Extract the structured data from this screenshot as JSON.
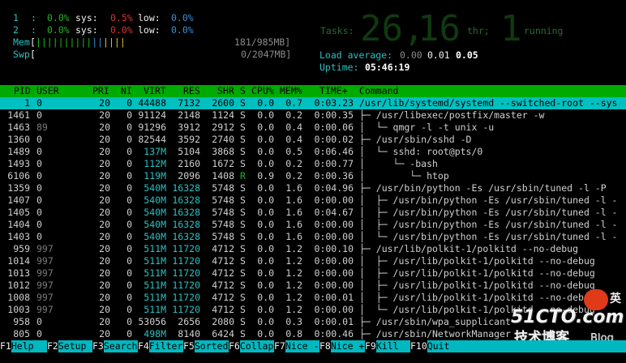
{
  "meters": {
    "cpu1": {
      "label": "1",
      "sep": ":",
      "user": "0.0%",
      "sys_label": "sys:",
      "sys": "0.5%",
      "low_label": "low:",
      "low": "0.0%"
    },
    "cpu2": {
      "label": "2",
      "sep": ":",
      "user": "0.0%",
      "sys_label": "sys:",
      "sys": "0.0%",
      "low_label": "low:",
      "low": "0.0%"
    },
    "mem": {
      "label": "Mem",
      "bar": "[||||||||||||||||",
      "value": "181/985MB]"
    },
    "swp": {
      "label": "Swp",
      "bar": "[",
      "value": "0/2047MB]"
    }
  },
  "stats": {
    "tasks_label": "Tasks:",
    "tasks": "26,",
    "thr_count": "16",
    "thr_label": "thr;",
    "running_count": "1",
    "running_label": "running",
    "load_label": "Load average:",
    "load1": "0.00",
    "load5": "0.01",
    "load15": "0.05",
    "uptime_label": "Uptime:",
    "uptime": "05:46:19"
  },
  "columns": [
    "PID",
    "USER",
    "PRI",
    "NI",
    "VIRT",
    "RES",
    "SHR",
    "S",
    "CPU%",
    "MEM%",
    "TIME+",
    "Command"
  ],
  "processes": [
    {
      "pid": "1",
      "user": "0",
      "pri": "20",
      "ni": "0",
      "virt": "44488",
      "res": "7132",
      "shr": "2600",
      "s": "S",
      "cpu": "0.0",
      "mem": "0.7",
      "time": "0:03.23",
      "cmd": "/usr/lib/systemd/systemd --switched-root --sys"
    },
    {
      "pid": "1461",
      "user": "0",
      "pri": "20",
      "ni": "0",
      "virt": "91124",
      "res": "2148",
      "shr": "1124",
      "s": "S",
      "cpu": "0.0",
      "mem": "0.2",
      "time": "0:00.35",
      "cmd": "├─ /usr/libexec/postfix/master -w"
    },
    {
      "pid": "1463",
      "user": "89",
      "pri": "20",
      "ni": "0",
      "virt": "91296",
      "res": "3912",
      "shr": "2912",
      "s": "S",
      "cpu": "0.0",
      "mem": "0.4",
      "time": "0:00.06",
      "cmd": "│  └─ qmgr -l -t unix -u"
    },
    {
      "pid": "1360",
      "user": "0",
      "pri": "20",
      "ni": "0",
      "virt": "82544",
      "res": "3592",
      "shr": "2740",
      "s": "S",
      "cpu": "0.0",
      "mem": "0.4",
      "time": "0:00.02",
      "cmd": "├─ /usr/sbin/sshd -D"
    },
    {
      "pid": "1489",
      "user": "0",
      "pri": "20",
      "ni": "0",
      "virt": "137M",
      "res": "5104",
      "shr": "3868",
      "s": "S",
      "cpu": "0.0",
      "mem": "0.5",
      "time": "0:06.46",
      "cmd": "│  └─ sshd: root@pts/0"
    },
    {
      "pid": "1493",
      "user": "0",
      "pri": "20",
      "ni": "0",
      "virt": "112M",
      "res": "2160",
      "shr": "1672",
      "s": "S",
      "cpu": "0.0",
      "mem": "0.2",
      "time": "0:00.77",
      "cmd": "│     └─ -bash"
    },
    {
      "pid": "6106",
      "user": "0",
      "pri": "20",
      "ni": "0",
      "virt": "119M",
      "res": "2096",
      "shr": "1408",
      "s": "R",
      "cpu": "0.9",
      "mem": "0.2",
      "time": "0:00.36",
      "cmd": "│        └─ htop"
    },
    {
      "pid": "1359",
      "user": "0",
      "pri": "20",
      "ni": "0",
      "virt": "540M",
      "res": "16328",
      "shr": "5748",
      "s": "S",
      "cpu": "0.0",
      "mem": "1.6",
      "time": "0:04.96",
      "cmd": "├─ /usr/bin/python -Es /usr/sbin/tuned -l -P"
    },
    {
      "pid": "1407",
      "user": "0",
      "pri": "20",
      "ni": "0",
      "virt": "540M",
      "res": "16328",
      "shr": "5748",
      "s": "S",
      "cpu": "0.0",
      "mem": "1.6",
      "time": "0:00.00",
      "cmd": "│  ├─ /usr/bin/python -Es /usr/sbin/tuned -l -"
    },
    {
      "pid": "1405",
      "user": "0",
      "pri": "20",
      "ni": "0",
      "virt": "540M",
      "res": "16328",
      "shr": "5748",
      "s": "S",
      "cpu": "0.0",
      "mem": "1.6",
      "time": "0:04.67",
      "cmd": "│  ├─ /usr/bin/python -Es /usr/sbin/tuned -l -"
    },
    {
      "pid": "1404",
      "user": "0",
      "pri": "20",
      "ni": "0",
      "virt": "540M",
      "res": "16328",
      "shr": "5748",
      "s": "S",
      "cpu": "0.0",
      "mem": "1.6",
      "time": "0:00.00",
      "cmd": "│  ├─ /usr/bin/python -Es /usr/sbin/tuned -l -"
    },
    {
      "pid": "1403",
      "user": "0",
      "pri": "20",
      "ni": "0",
      "virt": "540M",
      "res": "16328",
      "shr": "5748",
      "s": "S",
      "cpu": "0.0",
      "mem": "1.6",
      "time": "0:00.00",
      "cmd": "│  └─ /usr/bin/python -Es /usr/sbin/tuned -l -"
    },
    {
      "pid": "959",
      "user": "997",
      "pri": "20",
      "ni": "0",
      "virt": "511M",
      "res": "11720",
      "shr": "4712",
      "s": "S",
      "cpu": "0.0",
      "mem": "1.2",
      "time": "0:00.10",
      "cmd": "├─ /usr/lib/polkit-1/polkitd --no-debug"
    },
    {
      "pid": "1014",
      "user": "997",
      "pri": "20",
      "ni": "0",
      "virt": "511M",
      "res": "11720",
      "shr": "4712",
      "s": "S",
      "cpu": "0.0",
      "mem": "1.2",
      "time": "0:00.00",
      "cmd": "│  ├─ /usr/lib/polkit-1/polkitd --no-debug"
    },
    {
      "pid": "1013",
      "user": "997",
      "pri": "20",
      "ni": "0",
      "virt": "511M",
      "res": "11720",
      "shr": "4712",
      "s": "S",
      "cpu": "0.0",
      "mem": "1.2",
      "time": "0:00.00",
      "cmd": "│  ├─ /usr/lib/polkit-1/polkitd --no-debug"
    },
    {
      "pid": "1012",
      "user": "997",
      "pri": "20",
      "ni": "0",
      "virt": "511M",
      "res": "11720",
      "shr": "4712",
      "s": "S",
      "cpu": "0.0",
      "mem": "1.2",
      "time": "0:00.00",
      "cmd": "│  ├─ /usr/lib/polkit-1/polkitd --no-debug"
    },
    {
      "pid": "1008",
      "user": "997",
      "pri": "20",
      "ni": "0",
      "virt": "511M",
      "res": "11720",
      "shr": "4712",
      "s": "S",
      "cpu": "0.0",
      "mem": "1.2",
      "time": "0:00.01",
      "cmd": "│  ├─ /usr/lib/polkit-1/polkitd --no-debug"
    },
    {
      "pid": "1003",
      "user": "997",
      "pri": "20",
      "ni": "0",
      "virt": "511M",
      "res": "11720",
      "shr": "4712",
      "s": "S",
      "cpu": "0.0",
      "mem": "1.2",
      "time": "0:00.00",
      "cmd": "│  └─ /usr/lib/polkit-1/polkitd --no-debug"
    },
    {
      "pid": "958",
      "user": "0",
      "pri": "20",
      "ni": "0",
      "virt": "53056",
      "res": "2656",
      "shr": "2080",
      "s": "S",
      "cpu": "0.0",
      "mem": "0.3",
      "time": "0:00.01",
      "cmd": "├─ /usr/sbin/wpa_supplicant"
    },
    {
      "pid": "805",
      "user": "0",
      "pri": "20",
      "ni": "0",
      "virt": "498M",
      "res": "8140",
      "shr": "6424",
      "s": "S",
      "cpu": "0.0",
      "mem": "0.8",
      "time": "0:00.46",
      "cmd": "├─ /usr/sbin/NetworkManager"
    }
  ],
  "footer": [
    {
      "key": "F1",
      "label": "Help"
    },
    {
      "key": "F2",
      "label": "Setup"
    },
    {
      "key": "F3",
      "label": "Search"
    },
    {
      "key": "F4",
      "label": "Filter"
    },
    {
      "key": "F5",
      "label": "Sorted"
    },
    {
      "key": "F6",
      "label": "Collap"
    },
    {
      "key": "F7",
      "label": "Nice -"
    },
    {
      "key": "F8",
      "label": "Nice +"
    },
    {
      "key": "F9",
      "label": "Kill"
    },
    {
      "key": "F10",
      "label": "Quit"
    }
  ],
  "watermark": {
    "site": "51CTO.com",
    "tagline": "技术博客",
    "blog": "Blog",
    "badge": "英"
  },
  "colors": {
    "header_bg": "#00aa00",
    "selected_bg": "#00c0c0",
    "footer_label_bg": "#00b8c0"
  }
}
